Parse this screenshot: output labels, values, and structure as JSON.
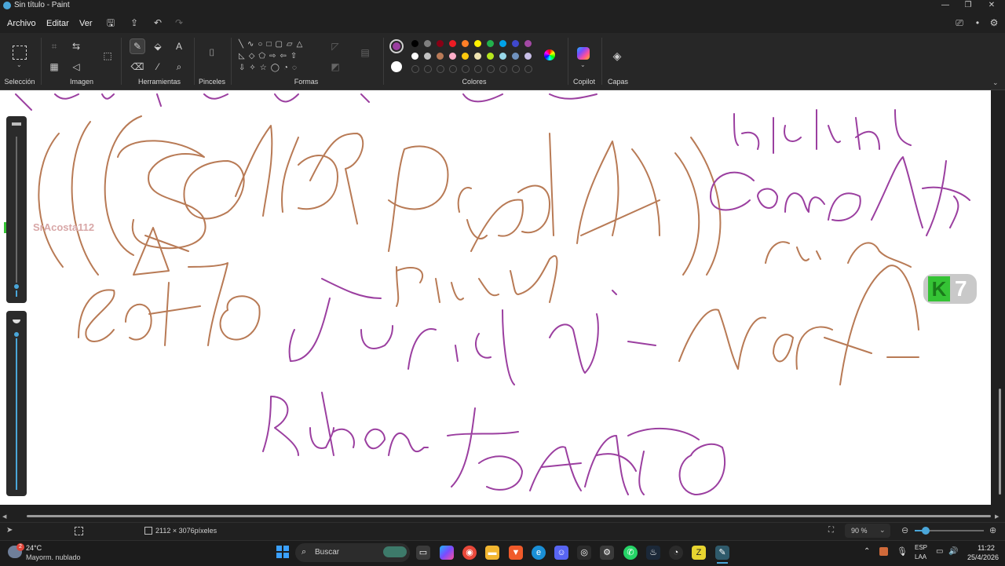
{
  "window": {
    "title": "Sin título - Paint"
  },
  "menu": {
    "items": [
      "Archivo",
      "Editar",
      "Ver"
    ]
  },
  "ribbon": {
    "groups": [
      "Selección",
      "Imagen",
      "Herramientas",
      "Pinceles",
      "Formas",
      "Colores",
      "Copilot",
      "Capas"
    ],
    "primary_color": "#9b3fa0",
    "palette_row1": [
      "#000000",
      "#7f7f7f",
      "#880015",
      "#ed1c24",
      "#ff7f27",
      "#fff200",
      "#22b14c",
      "#00a2e8",
      "#3f48cc",
      "#a349a4"
    ],
    "palette_row2": [
      "#ffffff",
      "#c3c3c3",
      "#b97a57",
      "#ffaec9",
      "#ffc90e",
      "#efe4b0",
      "#b5e61d",
      "#99d9ea",
      "#7092be",
      "#c8bfe7"
    ]
  },
  "canvas": {
    "handwriting": [
      "unichah",
      "Comaha",
      "SeñoR",
      "PiedrA",
      "Pinas",
      "sotto",
      "Jurich",
      "Macf",
      "Ruben",
      "tomato",
      "crin"
    ],
    "overlay_name": "SrAcosta112",
    "badge_letter": "K",
    "badge_number": "7"
  },
  "status": {
    "canvas_size": "2112 × 3076píxeles",
    "zoom": "90 %"
  },
  "taskbar": {
    "weather_temp": "24°C",
    "weather_desc": "Mayorm. nublado",
    "search_placeholder": "Buscar",
    "lang_line1": "ESP",
    "lang_line2": "LAA",
    "time": "11:22",
    "date": "25/4/2026"
  }
}
